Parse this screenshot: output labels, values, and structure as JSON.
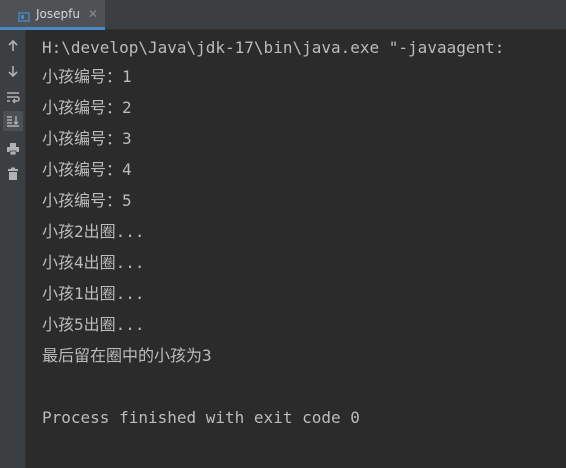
{
  "tab": {
    "label": "Josepfu",
    "close_glyph": "✕",
    "icon": "run-config-icon"
  },
  "toolbar": {
    "icons": [
      "arrow-up-icon",
      "arrow-down-icon",
      "soft-wrap-icon",
      "scroll-to-end-icon",
      "print-icon",
      "trash-icon"
    ]
  },
  "console": {
    "command": "H:\\develop\\Java\\jdk-17\\bin\\java.exe \"-javaagent:",
    "lines": [
      "小孩编号：1",
      "小孩编号：2",
      "小孩编号：3",
      "小孩编号：4",
      "小孩编号：5",
      "小孩2出圈...",
      "小孩4出圈...",
      "小孩1出圈...",
      "小孩5出圈...",
      "最后留在圈中的小孩为3"
    ],
    "exit_message": "Process finished with exit code 0"
  },
  "colors": {
    "background": "#2b2b2b",
    "panel": "#3c3f41",
    "text": "#bbbbbb",
    "accent": "#4a88c7"
  }
}
